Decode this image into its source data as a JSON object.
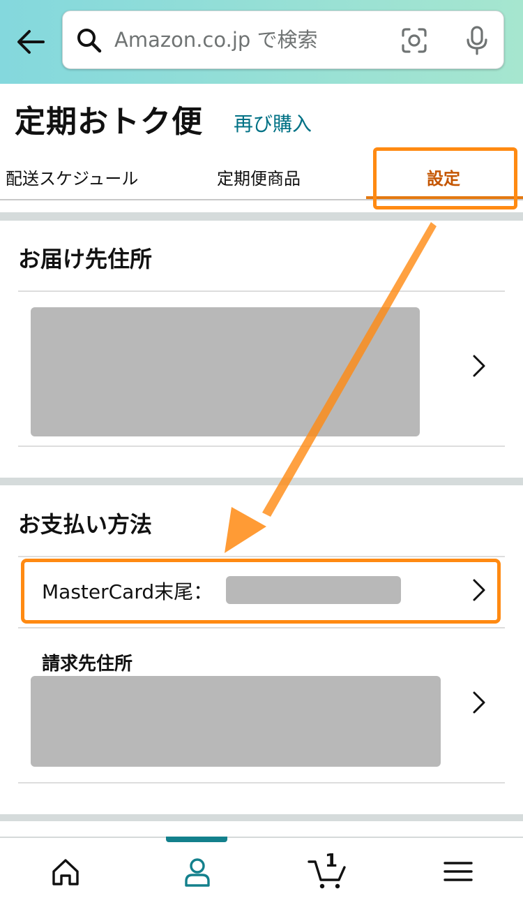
{
  "search": {
    "placeholder": "Amazon.co.jp で検索"
  },
  "header": {
    "title": "定期おトク便",
    "buy_again": "再び購入"
  },
  "tabs": [
    {
      "label": "配送スケジュール",
      "active": false
    },
    {
      "label": "定期便商品",
      "active": false
    },
    {
      "label": "設定",
      "active": true
    }
  ],
  "shipping": {
    "title": "お届け先住所"
  },
  "payment": {
    "title": "お支払い方法",
    "card_label": "MasterCard末尾：",
    "billing_title": "請求先住所"
  },
  "bottom_nav": {
    "items": [
      "home-icon",
      "account-icon",
      "cart-icon",
      "menu-icon"
    ],
    "active": "account-icon",
    "cart_count": "1"
  },
  "colors": {
    "header_gradient_start": "#84d8dd",
    "header_gradient_end": "#a6e6cf",
    "link": "#007185",
    "active_tab": "#c45500",
    "highlight": "#ff8a12",
    "nav_active": "#13808c"
  }
}
